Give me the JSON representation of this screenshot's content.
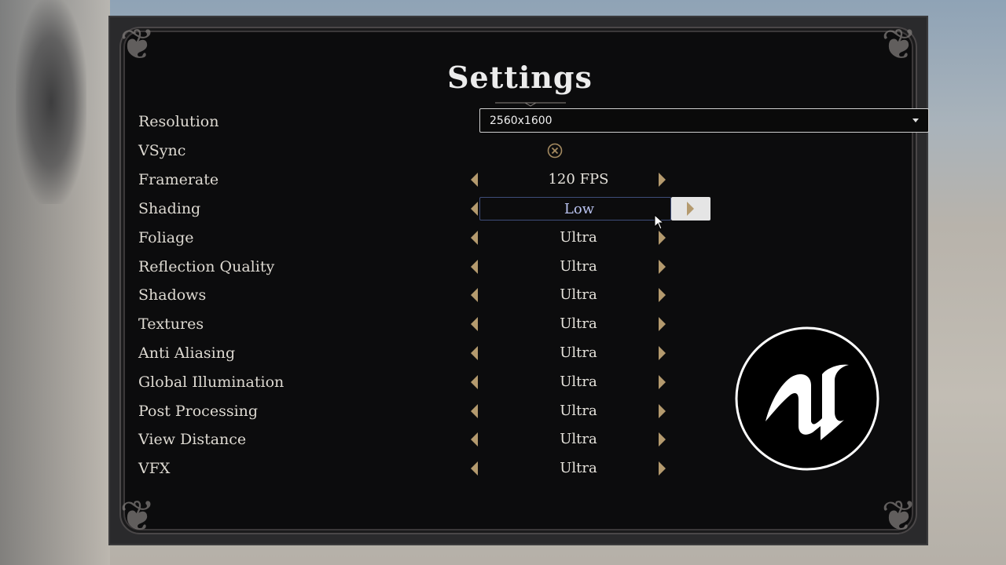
{
  "title": "Settings",
  "resolution": {
    "label": "Resolution",
    "value": "2560x1600"
  },
  "vsync": {
    "label": "VSync",
    "icon": "close-circle-icon",
    "enabled": false
  },
  "rows": [
    {
      "label": "Framerate",
      "value": "120 FPS"
    },
    {
      "label": "Shading",
      "value": "Low"
    },
    {
      "label": "Foliage",
      "value": "Ultra"
    },
    {
      "label": "Reflection Quality",
      "value": "Ultra"
    },
    {
      "label": "Shadows",
      "value": "Ultra"
    },
    {
      "label": "Textures",
      "value": "Ultra"
    },
    {
      "label": "Anti Aliasing",
      "value": "Ultra"
    },
    {
      "label": "Global Illumination",
      "value": "Ultra"
    },
    {
      "label": "Post Processing",
      "value": "Ultra"
    },
    {
      "label": "View Distance",
      "value": "Ultra"
    },
    {
      "label": "VFX",
      "value": "Ultra"
    }
  ],
  "logo": "unreal-engine-logo",
  "colors": {
    "panel": "#0c0c0d",
    "arrow": "#b49a6e",
    "selected_value": "#b9c2ef",
    "selected_border": "#3f4d7a"
  }
}
